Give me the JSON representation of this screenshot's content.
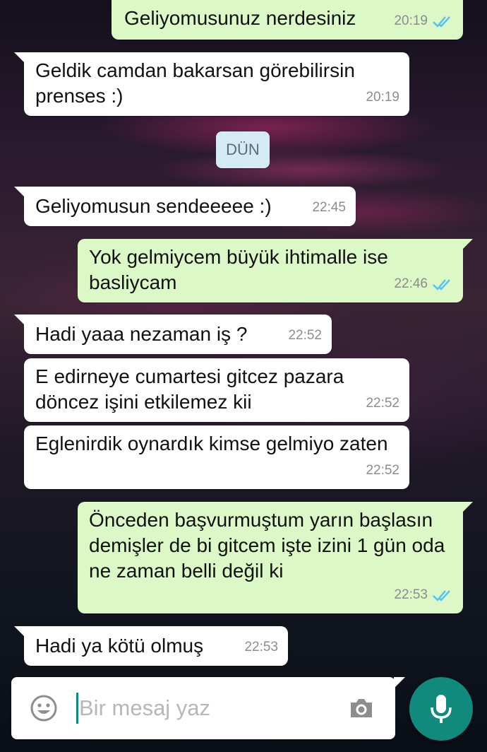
{
  "chat": {
    "date_separator": "DÜN",
    "messages": [
      {
        "direction": "out",
        "text": "Geliyomusunuz nerdesiniz",
        "time": "20:19",
        "status": "read"
      },
      {
        "direction": "in",
        "text": "Geldik camdan bakarsan görebilirsin prenses :)",
        "time": "20:19"
      },
      {
        "direction": "in",
        "text": "Geliyomusun sendeeeee :)",
        "time": "22:45"
      },
      {
        "direction": "out",
        "text": "Yok gelmiycem büyük ihtimalle ise basliycam",
        "time": "22:46",
        "status": "read"
      },
      {
        "direction": "in",
        "text": "Hadi yaaa nezaman iş ?",
        "time": "22:52"
      },
      {
        "direction": "in",
        "text": "E edirneye cumartesi gitcez pazara döncez işini etkilemez kii",
        "time": "22:52"
      },
      {
        "direction": "in",
        "text": "Eglenirdik oynardık kimse gelmiyo zaten",
        "time": "22:52"
      },
      {
        "direction": "out",
        "text": "Önceden başvurmuştum yarın başlasın demişler de bi gitcem işte izini 1 gün oda ne zaman belli değil ki",
        "time": "22:53",
        "status": "read"
      },
      {
        "direction": "in",
        "text": "Hadi ya kötü olmuş",
        "time": "22:53"
      }
    ]
  },
  "composer": {
    "placeholder": "Bir mesaj yaz",
    "left_icon": "emoji-icon",
    "right_icon": "camera-icon",
    "send_icon": "mic-icon"
  },
  "colors": {
    "outgoing_bubble": "#dcf8c6",
    "incoming_bubble": "#ffffff",
    "read_ticks": "#4fc3f7",
    "accent": "#0f8a7c",
    "date_chip": "#d4eaf4"
  }
}
